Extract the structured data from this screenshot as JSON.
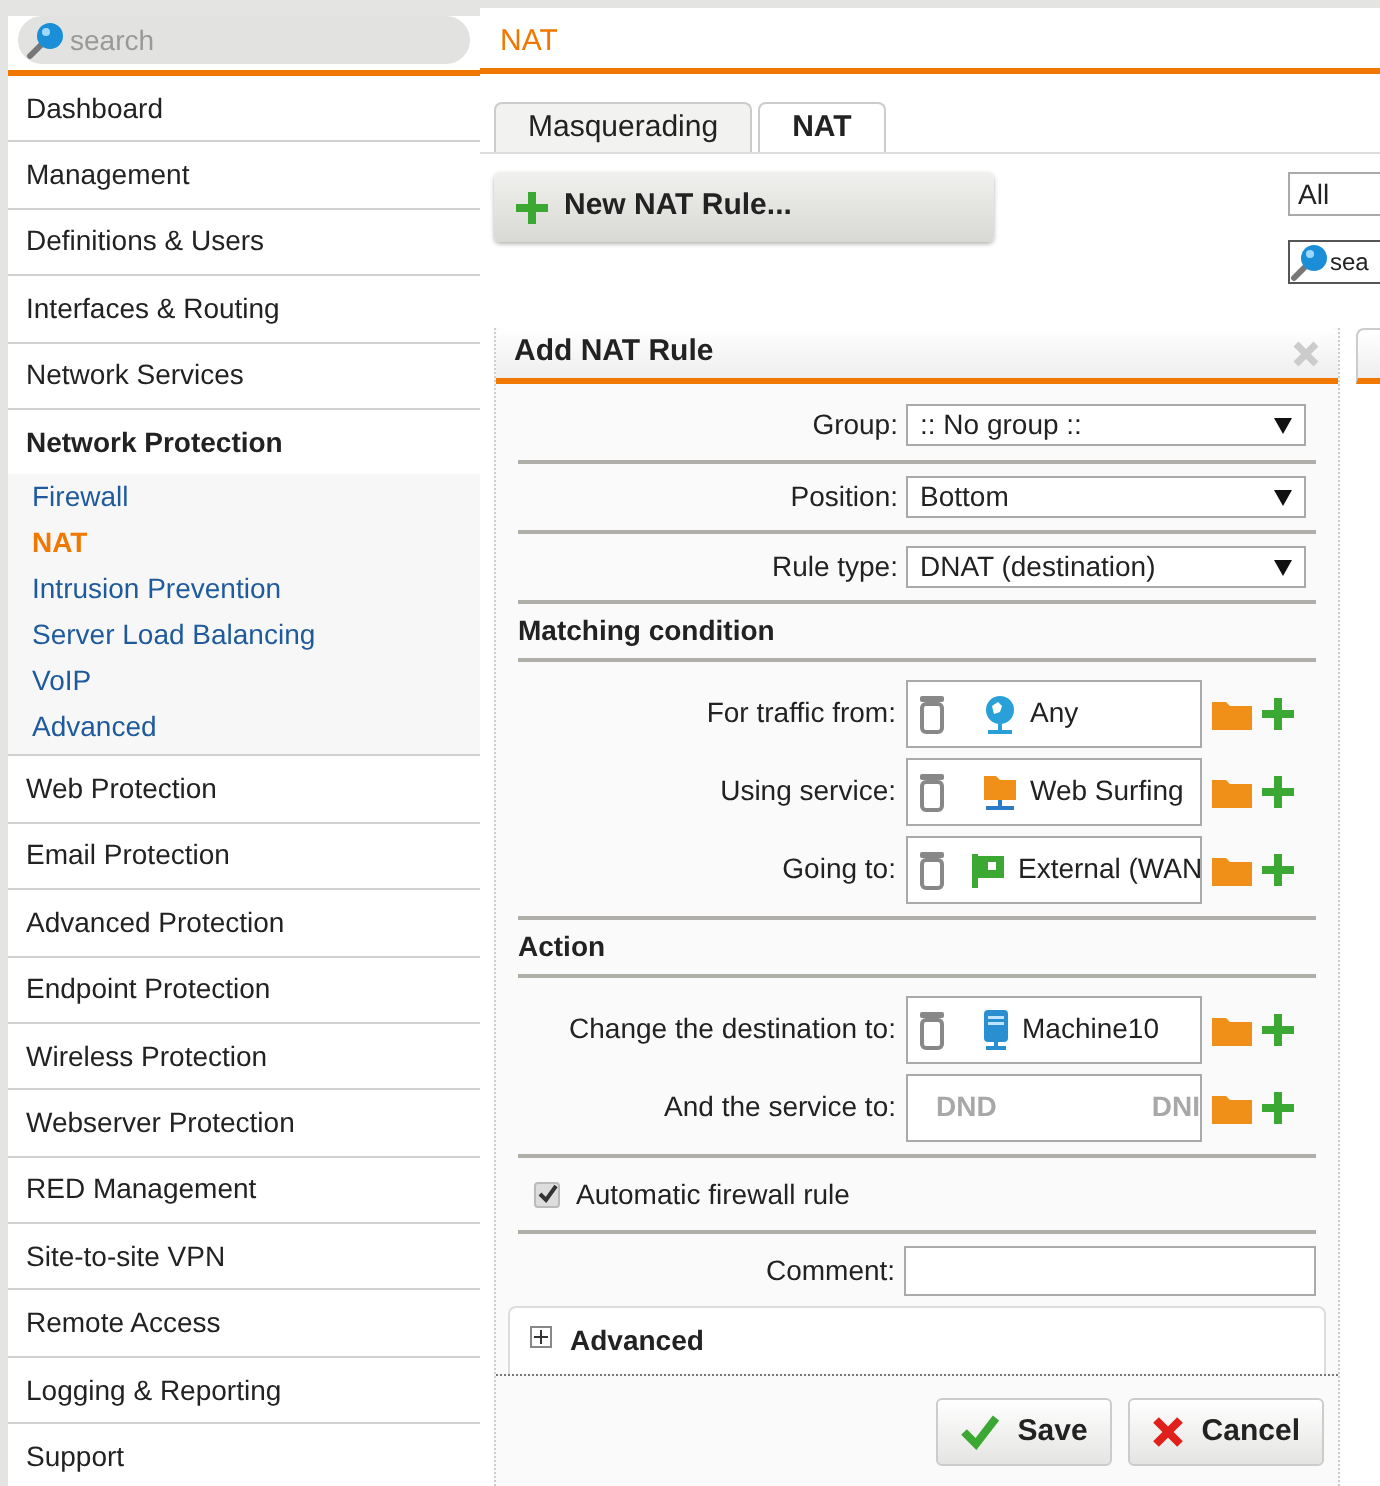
{
  "sidebar": {
    "search": {
      "placeholder": "search"
    },
    "items": [
      {
        "label": "Dashboard",
        "expanded": false
      },
      {
        "label": "Management",
        "expanded": false
      },
      {
        "label": "Definitions & Users",
        "expanded": false
      },
      {
        "label": "Interfaces & Routing",
        "expanded": false
      },
      {
        "label": "Network Services",
        "expanded": false
      },
      {
        "label": "Network Protection",
        "expanded": true,
        "children": [
          {
            "label": "Firewall",
            "selected": false
          },
          {
            "label": "NAT",
            "selected": true
          },
          {
            "label": "Intrusion Prevention",
            "selected": false
          },
          {
            "label": "Server Load Balancing",
            "selected": false
          },
          {
            "label": "VoIP",
            "selected": false
          },
          {
            "label": "Advanced",
            "selected": false
          }
        ]
      },
      {
        "label": "Web Protection",
        "expanded": false
      },
      {
        "label": "Email Protection",
        "expanded": false
      },
      {
        "label": "Advanced Protection",
        "expanded": false
      },
      {
        "label": "Endpoint Protection",
        "expanded": false
      },
      {
        "label": "Wireless Protection",
        "expanded": false
      },
      {
        "label": "Webserver Protection",
        "expanded": false
      },
      {
        "label": "RED Management",
        "expanded": false
      },
      {
        "label": "Site-to-site VPN",
        "expanded": false
      },
      {
        "label": "Remote Access",
        "expanded": false
      },
      {
        "label": "Logging & Reporting",
        "expanded": false
      },
      {
        "label": "Support",
        "expanded": false
      }
    ]
  },
  "page_title": "NAT",
  "tabs": [
    {
      "label": "Masquerading",
      "selected": false
    },
    {
      "label": "NAT",
      "selected": true
    }
  ],
  "new_rule_button": "New NAT Rule...",
  "filter": {
    "value": "All"
  },
  "search": {
    "placeholder": "sea"
  },
  "dialog": {
    "title": "Add NAT Rule",
    "selects": [
      {
        "label": "Group:",
        "value": ":: No group ::"
      },
      {
        "label": "Position:",
        "value": "Bottom"
      },
      {
        "label": "Rule type:",
        "value": "DNAT (destination)"
      }
    ],
    "sections": [
      {
        "title": "Matching condition",
        "rows": [
          {
            "label": "For traffic from:",
            "object": {
              "name": "Any",
              "kind": "network"
            }
          },
          {
            "label": "Using service:",
            "object": {
              "name": "Web Surfing",
              "kind": "service"
            }
          },
          {
            "label": "Going to:",
            "object": {
              "name": "External (WAN",
              "kind": "interface"
            }
          }
        ]
      },
      {
        "title": "Action",
        "rows": [
          {
            "label": "Change the destination to:",
            "object": {
              "name": "Machine10",
              "kind": "host"
            }
          },
          {
            "label": "And the service to:",
            "drop_hints": [
              "DND",
              "DNI"
            ]
          }
        ]
      }
    ],
    "auto_firewall": {
      "label": "Automatic firewall rule",
      "checked": true
    },
    "comment": {
      "label": "Comment:"
    },
    "advanced": {
      "label": "Advanced",
      "expanded": false
    },
    "buttons": [
      {
        "label": "Save",
        "kind": "save"
      },
      {
        "label": "Cancel",
        "kind": "cancel"
      }
    ]
  }
}
